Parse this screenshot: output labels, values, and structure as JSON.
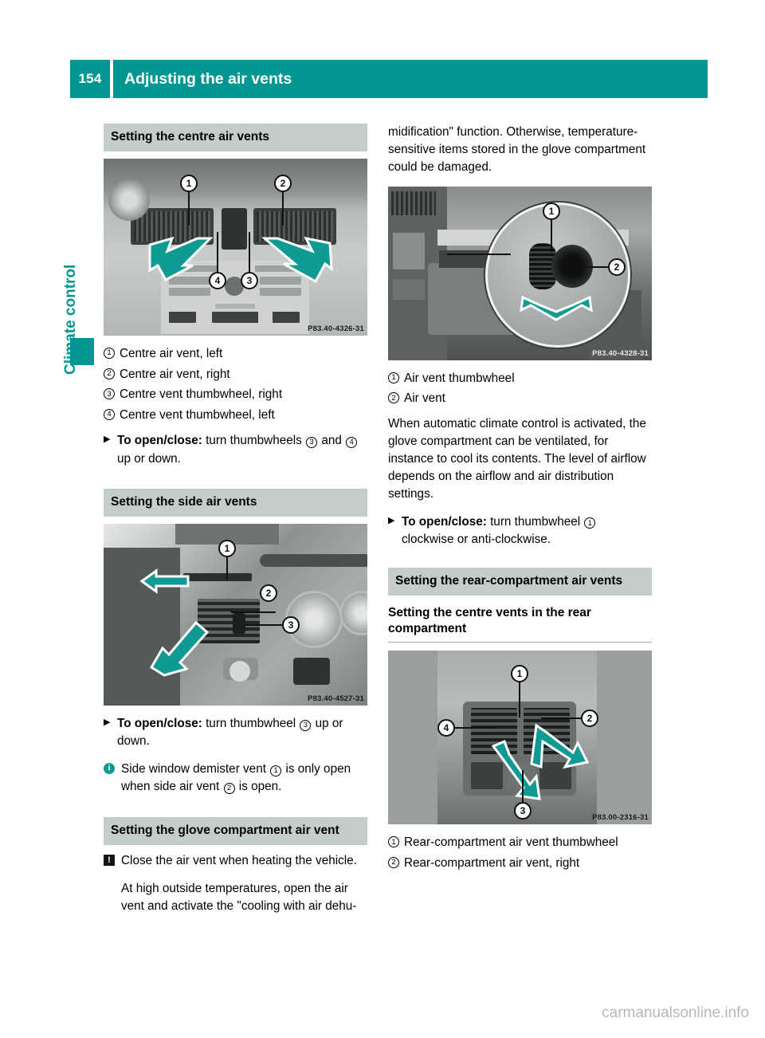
{
  "header": {
    "page_number": "154",
    "title": "Adjusting the air vents",
    "accent_color": "#009691"
  },
  "sidebar": {
    "chapter_label": "Climate control",
    "tab_color": "#009691"
  },
  "left_column": {
    "section1": {
      "heading": "Setting the centre air vents",
      "photo": {
        "code": "P83.40-4326-31",
        "callouts": [
          "1",
          "2",
          "3",
          "4"
        ]
      },
      "legend": [
        {
          "num": "1",
          "text": "Centre air vent, left"
        },
        {
          "num": "2",
          "text": "Centre air vent, right"
        },
        {
          "num": "3",
          "text": "Centre vent thumbwheel, right"
        },
        {
          "num": "4",
          "text": "Centre vent thumbwheel, left"
        }
      ],
      "action": {
        "bullet": "triangle-bullet",
        "label": "To open/close:",
        "text_before": "turn thumbwheels",
        "ref1": "3",
        "text_middle": "and",
        "ref2": "4",
        "text_after": "up or down."
      }
    },
    "section2": {
      "heading": "Setting the side air vents",
      "photo": {
        "code": "P83.40-4527-31",
        "callouts": [
          "1",
          "2",
          "3"
        ]
      },
      "action": {
        "bullet": "triangle-bullet",
        "label": "To open/close:",
        "text_before": "turn thumbwheel",
        "ref1": "3",
        "text_after": "up or down."
      },
      "note": {
        "icon": "info-icon",
        "text_before": "Side window demister vent",
        "ref1": "1",
        "text_middle": "is only open when side air vent",
        "ref2": "2",
        "text_after": "is open."
      }
    },
    "section3": {
      "heading": "Setting the glove compartment air vent",
      "warning": {
        "icon": "warning-icon",
        "text": "Close the air vent when heating the vehicle."
      },
      "paragraph": "At high outside temperatures, open the air vent and activate the \"cooling with air dehu-"
    }
  },
  "right_column": {
    "continued_paragraph": "midification\" function. Otherwise, temperature-sensitive items stored in the glove compartment could be damaged.",
    "photo1": {
      "code": "P83.40-4328-31",
      "callouts": [
        "1",
        "2"
      ]
    },
    "legend1": [
      {
        "num": "1",
        "text": "Air vent thumbwheel"
      },
      {
        "num": "2",
        "text": "Air vent"
      }
    ],
    "paragraph1": "When automatic climate control is activated, the glove compartment can be ventilated, for instance to cool its contents. The level of airflow depends on the airflow and air distribution settings.",
    "action1": {
      "bullet": "triangle-bullet",
      "label": "To open/close:",
      "text_before": "turn thumbwheel",
      "ref1": "1",
      "text_after": "clockwise or anti-clockwise."
    },
    "section_heading": "Setting the rear-compartment air vents",
    "sub_heading": "Setting the centre vents in the rear compartment",
    "photo2": {
      "code": "P83.00-2316-31",
      "callouts": [
        "1",
        "2",
        "3",
        "4"
      ]
    },
    "legend2": [
      {
        "num": "1",
        "text": "Rear-compartment air vent thumbwheel"
      },
      {
        "num": "2",
        "text": "Rear-compartment air vent, right"
      }
    ]
  },
  "footer": {
    "watermark": "carmanualsonline.info"
  }
}
